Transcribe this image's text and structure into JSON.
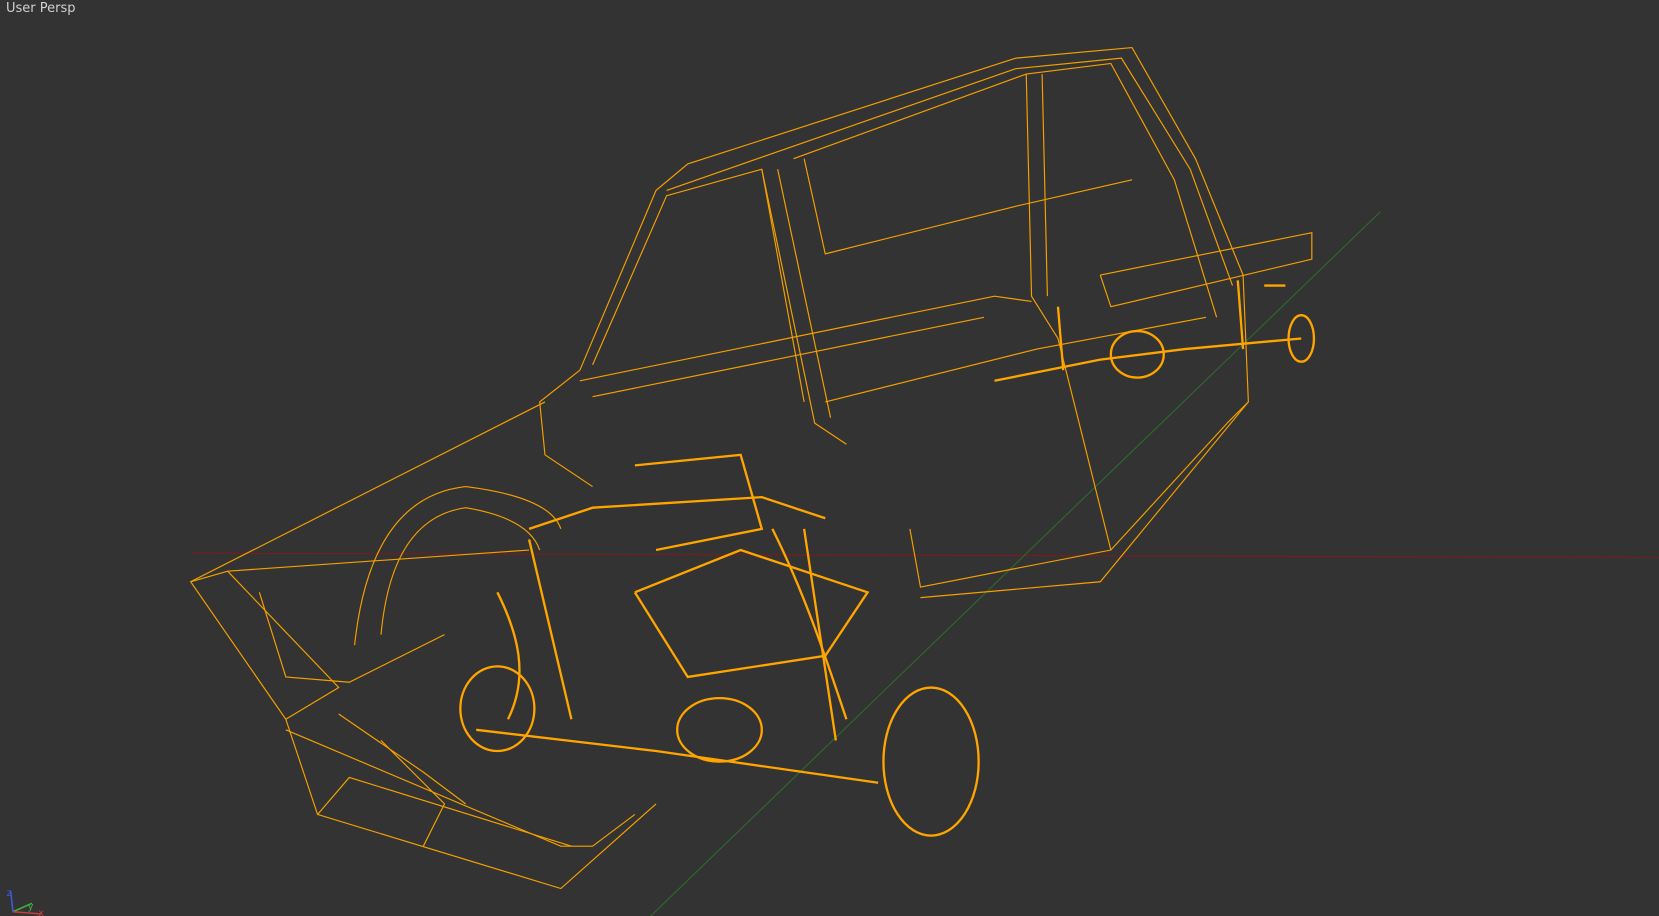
{
  "viewport": {
    "label": "User Persp",
    "render_mode": "wireframe",
    "background_color": "#333333",
    "wire_color": "#f5a000",
    "grid_axes": {
      "x_color": "#8b1a1a",
      "y_color": "#2e6b2e"
    }
  },
  "gizmo": {
    "x": "x",
    "y": "y",
    "z": "z"
  }
}
